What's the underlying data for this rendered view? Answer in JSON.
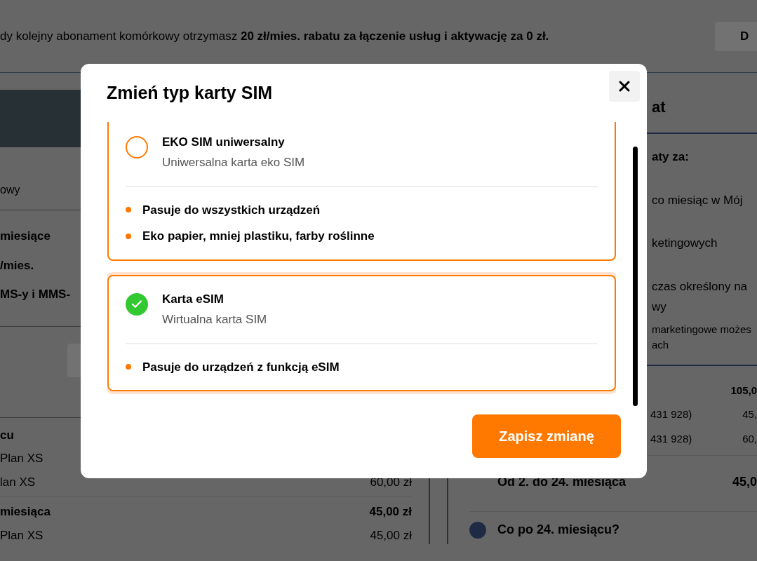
{
  "banner": {
    "text": "dy kolejny abonament komórkowy otrzymasz **20 zł/mies. rabatu za łączenie usług i aktywację za 0 zł.**",
    "button": "D"
  },
  "left_panel": {
    "top_rows": [
      {
        "label": "owy",
        "bold": false
      },
      {
        "label": "miesiące",
        "bold": true
      },
      {
        "label": "/mies.",
        "bold": true
      },
      {
        "label": "MS-y i MMS-",
        "bold": true
      }
    ],
    "cost_rows": [
      {
        "label": "cu",
        "amount": "",
        "bold": true
      },
      {
        "label": "Plan XS",
        "amount": "",
        "bold": false
      },
      {
        "label": "lan XS",
        "amount": "60,00 zł",
        "bold": false
      },
      {
        "label": "miesiąca",
        "amount": "45,00 zł",
        "bold": true
      },
      {
        "label": "Plan XS",
        "amount": "45,00 zł",
        "bold": false
      }
    ]
  },
  "right_panel": {
    "title": "at",
    "subtitle": "aty za:",
    "consents": [
      {
        "lines": [
          "co miesiąc w Mój"
        ]
      },
      {
        "lines": [
          "ketingowych"
        ]
      },
      {
        "lines": [
          "czas określony na",
          "wy"
        ]
      }
    ],
    "note": [
      "marketingowe możes",
      "ach"
    ],
    "cost_rows": [
      {
        "label": "",
        "amount": "105,0",
        "bold": true
      },
      {
        "label": "431 928)",
        "amount": "45,",
        "bold": false
      },
      {
        "label": "431 928)",
        "amount": "60,",
        "bold": false
      },
      {
        "label": "Od 2. do 24. miesiąca",
        "amount": "45,0",
        "bold": true
      }
    ],
    "question": "Co po 24. miesiącu?"
  },
  "modal": {
    "title": "Zmień typ karty SIM",
    "options": [
      {
        "title": "EKO SIM uniwersalny",
        "subtitle": "Uniwersalna karta eko SIM",
        "selected": false,
        "features": [
          "Pasuje do wszystkich urządzeń",
          "Eko papier, mniej plastiku, farby roślinne"
        ]
      },
      {
        "title": "Karta eSIM",
        "subtitle": "Wirtualna karta SIM",
        "selected": true,
        "features": [
          "Pasuje do urządzeń z funkcją eSIM"
        ]
      }
    ],
    "save_button": "Zapisz zmianę"
  }
}
